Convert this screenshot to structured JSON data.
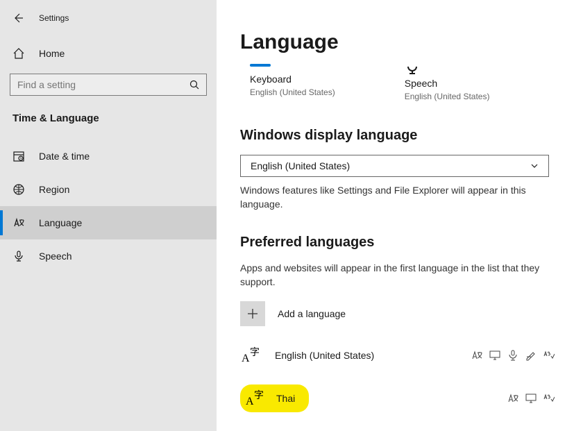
{
  "header": {
    "window_title": "Settings"
  },
  "sidebar": {
    "home_label": "Home",
    "search_placeholder": "Find a setting",
    "section_title": "Time & Language",
    "items": [
      {
        "key": "datetime",
        "label": "Date & time"
      },
      {
        "key": "region",
        "label": "Region"
      },
      {
        "key": "language",
        "label": "Language",
        "selected": true
      },
      {
        "key": "speech",
        "label": "Speech"
      }
    ]
  },
  "main": {
    "page_title": "Language",
    "tiles": [
      {
        "key": "keyboard",
        "label": "Keyboard",
        "value": "English (United States)"
      },
      {
        "key": "speech",
        "label": "Speech",
        "value": "English (United States)"
      }
    ],
    "display_lang": {
      "heading": "Windows display language",
      "selected": "English (United States)",
      "description": "Windows features like Settings and File Explorer will appear in this language."
    },
    "preferred": {
      "heading": "Preferred languages",
      "description": "Apps and websites will appear in the first language in the list that they support.",
      "add_label": "Add a language",
      "languages": [
        {
          "name": "English (United States)",
          "features": [
            "translate",
            "display",
            "speech",
            "handwriting",
            "spellcheck"
          ]
        },
        {
          "name": "Thai",
          "highlighted": true,
          "features": [
            "translate",
            "display",
            "spellcheck"
          ]
        }
      ]
    }
  }
}
